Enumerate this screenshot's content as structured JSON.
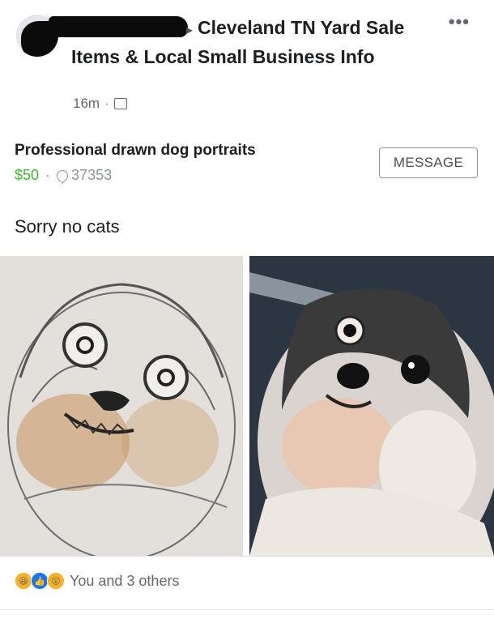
{
  "post": {
    "group_arrow": "▸",
    "group_name": "Cleveland TN Yard Sale Items & Local Small Business Info",
    "time": "16m",
    "more_icon": "ellipsis-icon"
  },
  "listing": {
    "title": "Professional drawn dog portraits",
    "price": "$50",
    "separator": "·",
    "zip": "37353",
    "message_button": "MESSAGE"
  },
  "body_text": "Sorry no cats",
  "photos": [
    {
      "kind": "drawing"
    },
    {
      "kind": "photo"
    }
  ],
  "reactions": {
    "icons": [
      "haha-icon",
      "like-icon",
      "wow-icon"
    ],
    "text": "You and 3 others"
  }
}
